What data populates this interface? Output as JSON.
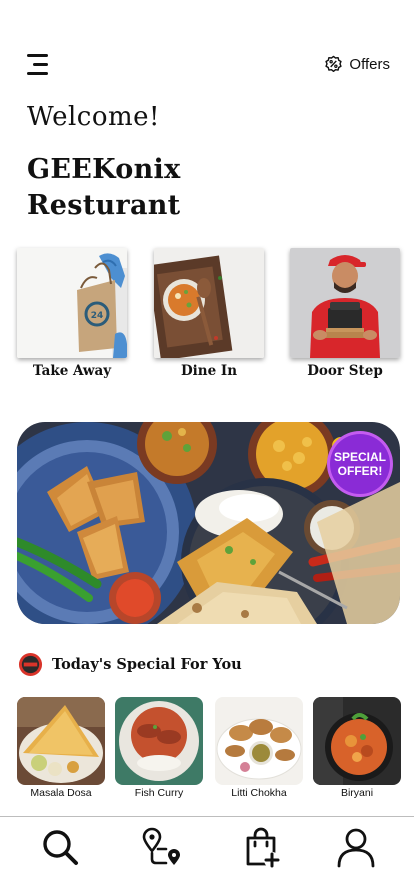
{
  "header": {
    "menu_icon": "hamburger-menu-icon",
    "offers_icon": "discount-badge-icon",
    "offers_label": "Offers"
  },
  "greeting": "Welcome!",
  "brand": {
    "line1": "GEEKonix",
    "line2": "Resturant"
  },
  "service_modes": [
    {
      "label": "Take Away",
      "image": "take-away-bag"
    },
    {
      "label": "Dine In",
      "image": "dine-in-dish"
    },
    {
      "label": "Door Step",
      "image": "delivery-person"
    }
  ],
  "banner": {
    "badge_line1": "SPECIAL",
    "badge_line2": "OFFER!",
    "badge_color": "#8a2bd6"
  },
  "todays_special": {
    "title": "Today's Special For You",
    "items": [
      {
        "label": "Masala Dosa"
      },
      {
        "label": "Fish Curry"
      },
      {
        "label": "Litti Chokha"
      },
      {
        "label": "Biryani"
      }
    ]
  },
  "bottom_nav": [
    {
      "icon": "search-icon"
    },
    {
      "icon": "location-route-icon"
    },
    {
      "icon": "shopping-bag-add-icon"
    },
    {
      "icon": "user-profile-icon"
    }
  ]
}
